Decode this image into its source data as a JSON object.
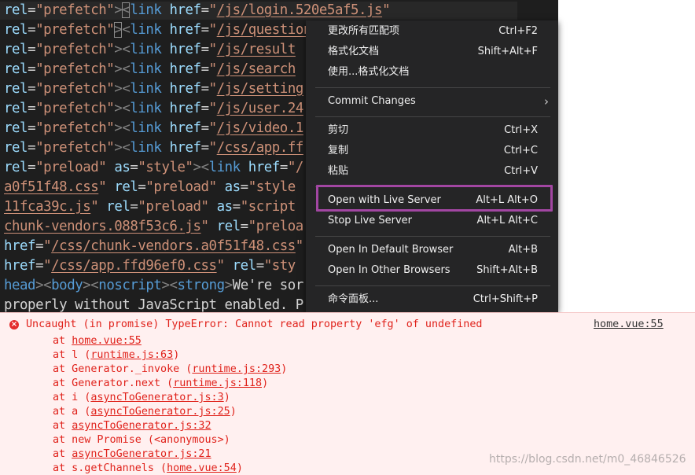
{
  "editor": {
    "lines": [
      [
        [
          "attr",
          "rel"
        ],
        [
          "eq",
          "="
        ],
        [
          "str",
          "\"prefetch\""
        ],
        [
          "punc",
          ">"
        ],
        [
          "punc|bx",
          "<"
        ],
        [
          "tag",
          "link"
        ],
        [
          "txt",
          " "
        ],
        [
          "attr",
          "href"
        ],
        [
          "eq",
          "="
        ],
        [
          "str",
          "\""
        ],
        [
          "str|u",
          "/js/login.520e5af5.js"
        ],
        [
          "str",
          "\""
        ]
      ],
      [
        [
          "attr",
          "rel"
        ],
        [
          "eq",
          "="
        ],
        [
          "str",
          "\"prefetch\""
        ],
        [
          "punc|bx",
          ">"
        ],
        [
          "punc",
          "<"
        ],
        [
          "tag",
          "link"
        ],
        [
          "txt",
          " "
        ],
        [
          "attr",
          "href"
        ],
        [
          "eq",
          "="
        ],
        [
          "str",
          "\""
        ],
        [
          "str|u",
          "/js/question"
        ]
      ],
      [
        [
          "attr",
          "rel"
        ],
        [
          "eq",
          "="
        ],
        [
          "str",
          "\"prefetch\""
        ],
        [
          "punc",
          ">"
        ],
        [
          "punc",
          "<"
        ],
        [
          "tag",
          "link"
        ],
        [
          "txt",
          " "
        ],
        [
          "attr",
          "href"
        ],
        [
          "eq",
          "="
        ],
        [
          "str",
          "\""
        ],
        [
          "str|u",
          "/js/result"
        ]
      ],
      [
        [
          "attr",
          "rel"
        ],
        [
          "eq",
          "="
        ],
        [
          "str",
          "\"prefetch\""
        ],
        [
          "punc",
          ">"
        ],
        [
          "punc",
          "<"
        ],
        [
          "tag",
          "link"
        ],
        [
          "txt",
          " "
        ],
        [
          "attr",
          "href"
        ],
        [
          "eq",
          "="
        ],
        [
          "str",
          "\""
        ],
        [
          "str|u",
          "/js/search"
        ]
      ],
      [
        [
          "attr",
          "rel"
        ],
        [
          "eq",
          "="
        ],
        [
          "str",
          "\"prefetch\""
        ],
        [
          "punc",
          ">"
        ],
        [
          "punc",
          "<"
        ],
        [
          "tag",
          "link"
        ],
        [
          "txt",
          " "
        ],
        [
          "attr",
          "href"
        ],
        [
          "eq",
          "="
        ],
        [
          "str",
          "\""
        ],
        [
          "str|u",
          "/js/setting"
        ]
      ],
      [
        [
          "attr",
          "rel"
        ],
        [
          "eq",
          "="
        ],
        [
          "str",
          "\"prefetch\""
        ],
        [
          "punc",
          ">"
        ],
        [
          "punc",
          "<"
        ],
        [
          "tag",
          "link"
        ],
        [
          "txt",
          " "
        ],
        [
          "attr",
          "href"
        ],
        [
          "eq",
          "="
        ],
        [
          "str",
          "\""
        ],
        [
          "str|u",
          "/js/user.24"
        ]
      ],
      [
        [
          "attr",
          "rel"
        ],
        [
          "eq",
          "="
        ],
        [
          "str",
          "\"prefetch\""
        ],
        [
          "punc",
          ">"
        ],
        [
          "punc",
          "<"
        ],
        [
          "tag",
          "link"
        ],
        [
          "txt",
          " "
        ],
        [
          "attr",
          "href"
        ],
        [
          "eq",
          "="
        ],
        [
          "str",
          "\""
        ],
        [
          "str|u",
          "/js/video.1"
        ]
      ],
      [
        [
          "attr",
          "rel"
        ],
        [
          "eq",
          "="
        ],
        [
          "str",
          "\"prefetch\""
        ],
        [
          "punc",
          ">"
        ],
        [
          "punc",
          "<"
        ],
        [
          "tag",
          "link"
        ],
        [
          "txt",
          " "
        ],
        [
          "attr",
          "href"
        ],
        [
          "eq",
          "="
        ],
        [
          "str",
          "\""
        ],
        [
          "str|u",
          "/css/app.ff"
        ]
      ],
      [
        [
          "attr",
          "rel"
        ],
        [
          "eq",
          "="
        ],
        [
          "str",
          "\"preload\""
        ],
        [
          "txt",
          " "
        ],
        [
          "attr",
          "as"
        ],
        [
          "eq",
          "="
        ],
        [
          "str",
          "\"style\""
        ],
        [
          "punc",
          ">"
        ],
        [
          "punc",
          "<"
        ],
        [
          "tag",
          "link"
        ],
        [
          "txt",
          " "
        ],
        [
          "attr",
          "href"
        ],
        [
          "eq",
          "="
        ],
        [
          "str",
          "\"/"
        ]
      ],
      [
        [
          "str|u",
          "a0f51f48.css"
        ],
        [
          "str",
          "\""
        ],
        [
          "txt",
          " "
        ],
        [
          "attr",
          "rel"
        ],
        [
          "eq",
          "="
        ],
        [
          "str",
          "\"preload\""
        ],
        [
          "txt",
          " "
        ],
        [
          "attr",
          "as"
        ],
        [
          "eq",
          "="
        ],
        [
          "str",
          "\"style"
        ]
      ],
      [
        [
          "str|u",
          "11fca39c.js"
        ],
        [
          "str",
          "\""
        ],
        [
          "txt",
          " "
        ],
        [
          "attr",
          "rel"
        ],
        [
          "eq",
          "="
        ],
        [
          "str",
          "\"preload\""
        ],
        [
          "txt",
          " "
        ],
        [
          "attr",
          "as"
        ],
        [
          "eq",
          "="
        ],
        [
          "str",
          "\"script"
        ]
      ],
      [
        [
          "str|u",
          "chunk-vendors.088f53c6.js"
        ],
        [
          "str",
          "\""
        ],
        [
          "txt",
          " "
        ],
        [
          "attr",
          "rel"
        ],
        [
          "eq",
          "="
        ],
        [
          "str",
          "\"preloa"
        ]
      ],
      [
        [
          "attr",
          "href"
        ],
        [
          "eq",
          "="
        ],
        [
          "str",
          "\""
        ],
        [
          "str|u",
          "/css/chunk-vendors.a0f51f48.css"
        ],
        [
          "str",
          "\""
        ]
      ],
      [
        [
          "attr",
          "href"
        ],
        [
          "eq",
          "="
        ],
        [
          "str",
          "\""
        ],
        [
          "str|u",
          "/css/app.ffd96ef0.css"
        ],
        [
          "str",
          "\""
        ],
        [
          "txt",
          " "
        ],
        [
          "attr",
          "rel"
        ],
        [
          "eq",
          "="
        ],
        [
          "str",
          "\"sty"
        ]
      ],
      [
        [
          "tag",
          "head"
        ],
        [
          "punc",
          ">"
        ],
        [
          "punc",
          "<"
        ],
        [
          "tag",
          "body"
        ],
        [
          "punc",
          "><"
        ],
        [
          "tag",
          "noscript"
        ],
        [
          "punc",
          "><"
        ],
        [
          "tag",
          "strong"
        ],
        [
          "punc",
          ">"
        ],
        [
          "txt",
          "We're sor"
        ]
      ],
      [
        [
          "txt",
          "properly without JavaScript enabled. P"
        ]
      ]
    ]
  },
  "context_menu": {
    "groups": [
      [
        {
          "label": "更改所有匹配项",
          "shortcut": "Ctrl+F2"
        },
        {
          "label": "格式化文档",
          "shortcut": "Shift+Alt+F"
        },
        {
          "label": "使用...格式化文档",
          "shortcut": ""
        }
      ],
      [
        {
          "label": "Commit Changes",
          "shortcut": "",
          "submenu": true,
          "chevron": "›"
        }
      ],
      [
        {
          "label": "剪切",
          "shortcut": "Ctrl+X"
        },
        {
          "label": "复制",
          "shortcut": "Ctrl+C"
        },
        {
          "label": "粘贴",
          "shortcut": "Ctrl+V"
        }
      ],
      [
        {
          "label": "Open with Live Server",
          "shortcut": "Alt+L Alt+O",
          "highlighted": true
        },
        {
          "label": "Stop Live Server",
          "shortcut": "Alt+L Alt+C"
        }
      ],
      [
        {
          "label": "Open In Default Browser",
          "shortcut": "Alt+B"
        },
        {
          "label": "Open In Other Browsers",
          "shortcut": "Shift+Alt+B"
        }
      ],
      [
        {
          "label": "命令面板...",
          "shortcut": "Ctrl+Shift+P"
        }
      ]
    ],
    "highlight_color": "#a246a2"
  },
  "console": {
    "error_icon": "error-circle-icon",
    "error_icon_glyph": "×",
    "error_message": "Uncaught (in promise) TypeError: Cannot read property 'efg' of undefined",
    "error_source": "home.vue:55",
    "stack": [
      {
        "prefix": "at ",
        "link": "home.vue:55",
        "suffix": ""
      },
      {
        "prefix": "at l (",
        "link": "runtime.js:63",
        "suffix": ")"
      },
      {
        "prefix": "at Generator._invoke (",
        "link": "runtime.js:293",
        "suffix": ")"
      },
      {
        "prefix": "at Generator.next (",
        "link": "runtime.js:118",
        "suffix": ")"
      },
      {
        "prefix": "at i (",
        "link": "asyncToGenerator.js:3",
        "suffix": ")"
      },
      {
        "prefix": "at a (",
        "link": "asyncToGenerator.js:25",
        "suffix": ")"
      },
      {
        "prefix": "at ",
        "link": "asyncToGenerator.js:32",
        "suffix": ""
      },
      {
        "prefix": "at new Promise (<anonymous>)",
        "link": "",
        "suffix": ""
      },
      {
        "prefix": "at ",
        "link": "asyncToGenerator.js:21",
        "suffix": ""
      },
      {
        "prefix": "at s.getChannels (",
        "link": "home.vue:54",
        "suffix": ")"
      }
    ],
    "error_color": "#e0221b",
    "background": "#fff0f0"
  },
  "watermark": "https://blog.csdn.net/m0_46846526"
}
